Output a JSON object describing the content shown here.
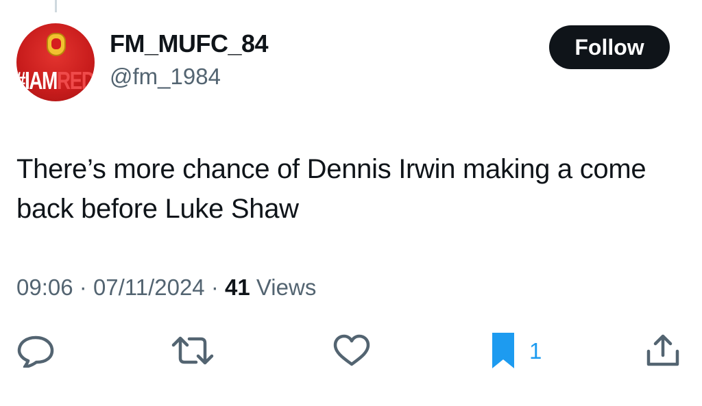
{
  "tweet": {
    "author": {
      "display_name": "FM_MUFC_84",
      "handle": "@fm_1984",
      "avatar": {
        "wordmark_white": "#IAM",
        "wordmark_red": "RED",
        "background_color": "#c81c1c"
      }
    },
    "follow_label": "Follow",
    "text": "There’s more chance of Dennis Irwin making a come back before Luke Shaw",
    "time": "09:06",
    "separator": "·",
    "date": "07/11/2024",
    "views_count": "41",
    "views_label": "Views"
  },
  "actions": {
    "reply_icon": "reply-icon",
    "retweet_icon": "retweet-icon",
    "like_icon": "heart-icon",
    "bookmark_icon": "bookmark-icon",
    "bookmark_count": "1",
    "share_icon": "share-icon"
  },
  "colors": {
    "text_primary": "#0f1419",
    "text_secondary": "#536471",
    "accent_blue": "#1d9bf0",
    "follow_button_bg": "#0f1419"
  }
}
